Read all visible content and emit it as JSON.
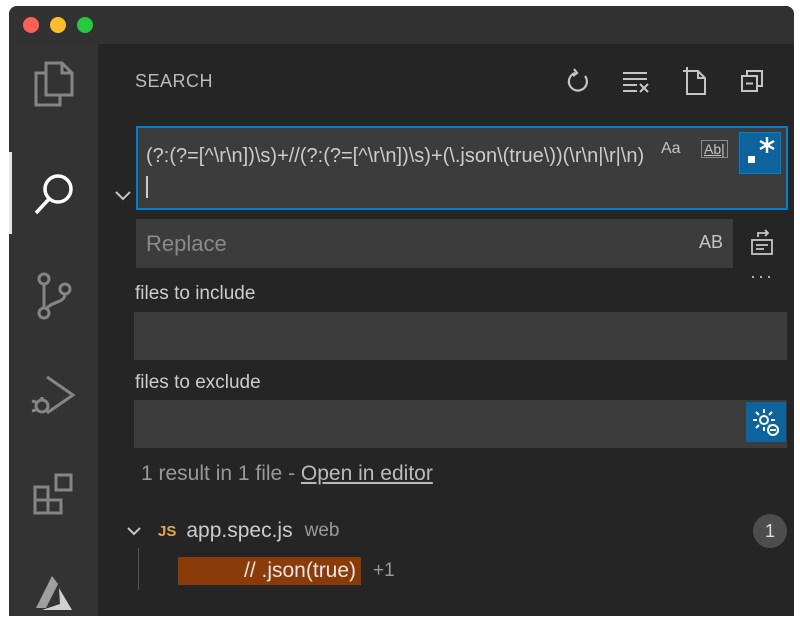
{
  "window": {
    "title": ""
  },
  "activity_bar": {
    "items": [
      {
        "name": "explorer",
        "icon": "files-icon"
      },
      {
        "name": "search",
        "icon": "search-icon",
        "active": true
      },
      {
        "name": "source-control",
        "icon": "source-control-icon"
      },
      {
        "name": "run-debug",
        "icon": "run-debug-icon"
      },
      {
        "name": "extensions",
        "icon": "extensions-icon"
      },
      {
        "name": "azure",
        "icon": "azure-icon"
      }
    ]
  },
  "search_panel": {
    "title": "SEARCH",
    "header_actions": [
      "refresh-icon",
      "clear-results-icon",
      "new-search-editor-icon",
      "collapse-all-icon"
    ],
    "search_value": "(?:(?=[^\\r\\n])\\s)+//(?:(?=[^\\r\\n])\\s)+(\\.json\\(true\\))(\\r\\n|\\r|\\n)",
    "match_case_label": "Aa",
    "whole_word_label": "Ab|",
    "regex_label": ".*",
    "regex_enabled": true,
    "replace_placeholder": "Replace",
    "preserve_case_label": "AB",
    "more_label": "···",
    "include_label": "files to include",
    "include_value": "",
    "exclude_label": "files to exclude",
    "exclude_value": "",
    "summary_text": "1 result in 1 file - ",
    "summary_link": "Open in editor"
  },
  "results": [
    {
      "language_badge": "JS",
      "file_name": "app.spec.js",
      "directory": "web",
      "count": "1",
      "matches": [
        {
          "text": "// .json(true)",
          "suffix": "+1"
        }
      ]
    }
  ],
  "colors": {
    "accent": "#007fd4",
    "active_toggle": "#0e639c",
    "match_highlight": "#8b3b0a",
    "js_badge": "#e7a84b"
  }
}
